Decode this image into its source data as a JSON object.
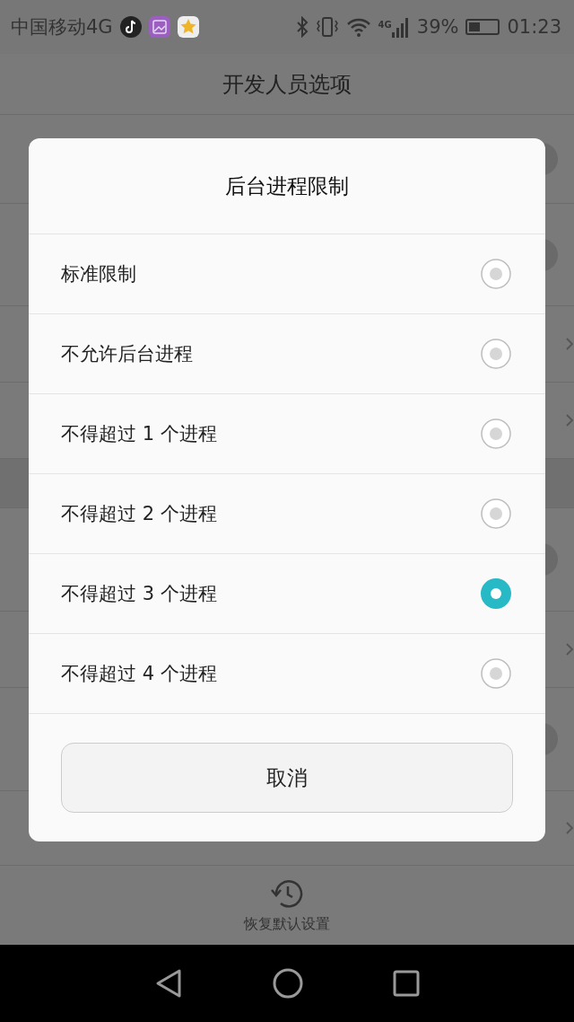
{
  "status_bar": {
    "carrier": "中国移动4G",
    "network": "4G",
    "battery_percent": "39%",
    "time": "01:23"
  },
  "header": {
    "title": "开发人员选项"
  },
  "background_rows": [
    {
      "kind": "switch",
      "on": false
    },
    {
      "kind": "switch",
      "on": false
    },
    {
      "kind": "chevron"
    },
    {
      "kind": "chevron"
    },
    {
      "kind": "section"
    },
    {
      "kind": "switch",
      "on": false
    },
    {
      "kind": "chevron"
    },
    {
      "kind": "switch",
      "on": false
    },
    {
      "kind": "chevron"
    }
  ],
  "dialog": {
    "title": "后台进程限制",
    "options": [
      {
        "label": "标准限制",
        "selected": false
      },
      {
        "label": "不允许后台进程",
        "selected": false
      },
      {
        "label": "不得超过 1 个进程",
        "selected": false
      },
      {
        "label": "不得超过 2 个进程",
        "selected": false
      },
      {
        "label": "不得超过 3 个进程",
        "selected": true
      },
      {
        "label": "不得超过 4 个进程",
        "selected": false
      }
    ],
    "cancel": "取消"
  },
  "footer": {
    "restore_label": "恢复默认设置"
  }
}
